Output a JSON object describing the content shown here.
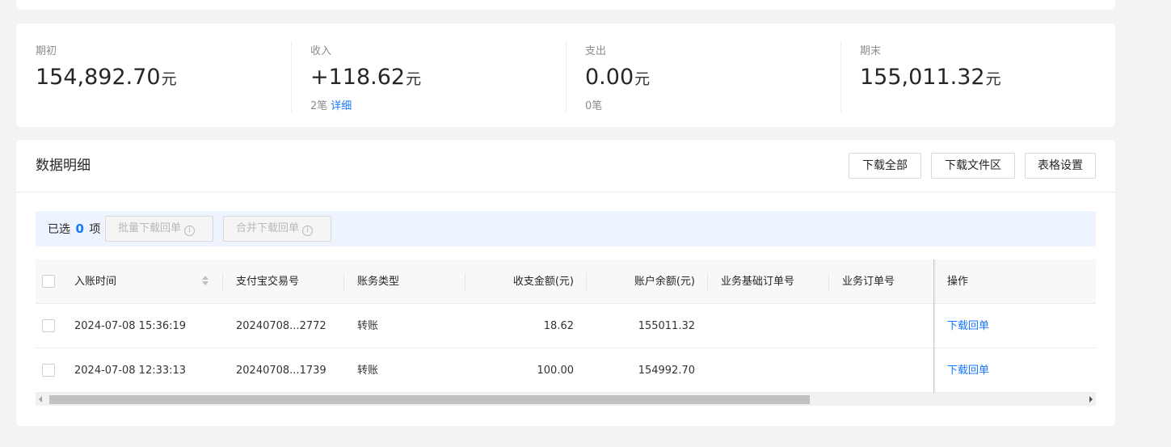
{
  "summary": {
    "opening": {
      "label": "期初",
      "amount": "154,892.70",
      "unit": "元"
    },
    "income": {
      "label": "收入",
      "amount": "+118.62",
      "unit": "元",
      "count": "2笔",
      "detail_link": "详细"
    },
    "expense": {
      "label": "支出",
      "amount": "0.00",
      "unit": "元",
      "count": "0笔"
    },
    "closing": {
      "label": "期末",
      "amount": "155,011.32",
      "unit": "元"
    }
  },
  "detail": {
    "title": "数据明细",
    "buttons": {
      "download_all": "下载全部",
      "download_area": "下载文件区",
      "table_settings": "表格设置"
    },
    "selection": {
      "prefix": "已选",
      "count": "0",
      "suffix": "项",
      "batch_download": "批量下载回单",
      "merge_download": "合并下载回单"
    },
    "table": {
      "headers": {
        "time": "入账时间",
        "alipay_no": "支付宝交易号",
        "type": "账务类型",
        "amount": "收支金额(元)",
        "balance": "账户余额(元)",
        "base_order": "业务基础订单号",
        "order": "业务订单号",
        "action": "操作"
      },
      "rows": [
        {
          "time": "2024-07-08 15:36:19",
          "alipay_no": "20240708...2772",
          "type": "转账",
          "amount": "18.62",
          "balance": "155011.32",
          "base_order": "",
          "order": "",
          "action": "下载回单"
        },
        {
          "time": "2024-07-08 12:33:13",
          "alipay_no": "20240708...1739",
          "type": "转账",
          "amount": "100.00",
          "balance": "154992.70",
          "base_order": "",
          "order": "",
          "action": "下载回单"
        }
      ]
    },
    "scrollbar_position": 0
  },
  "colors": {
    "accent": "#1677ff",
    "page_bg": "#f3f3f3",
    "select_bar_bg": "#eef4ff"
  }
}
